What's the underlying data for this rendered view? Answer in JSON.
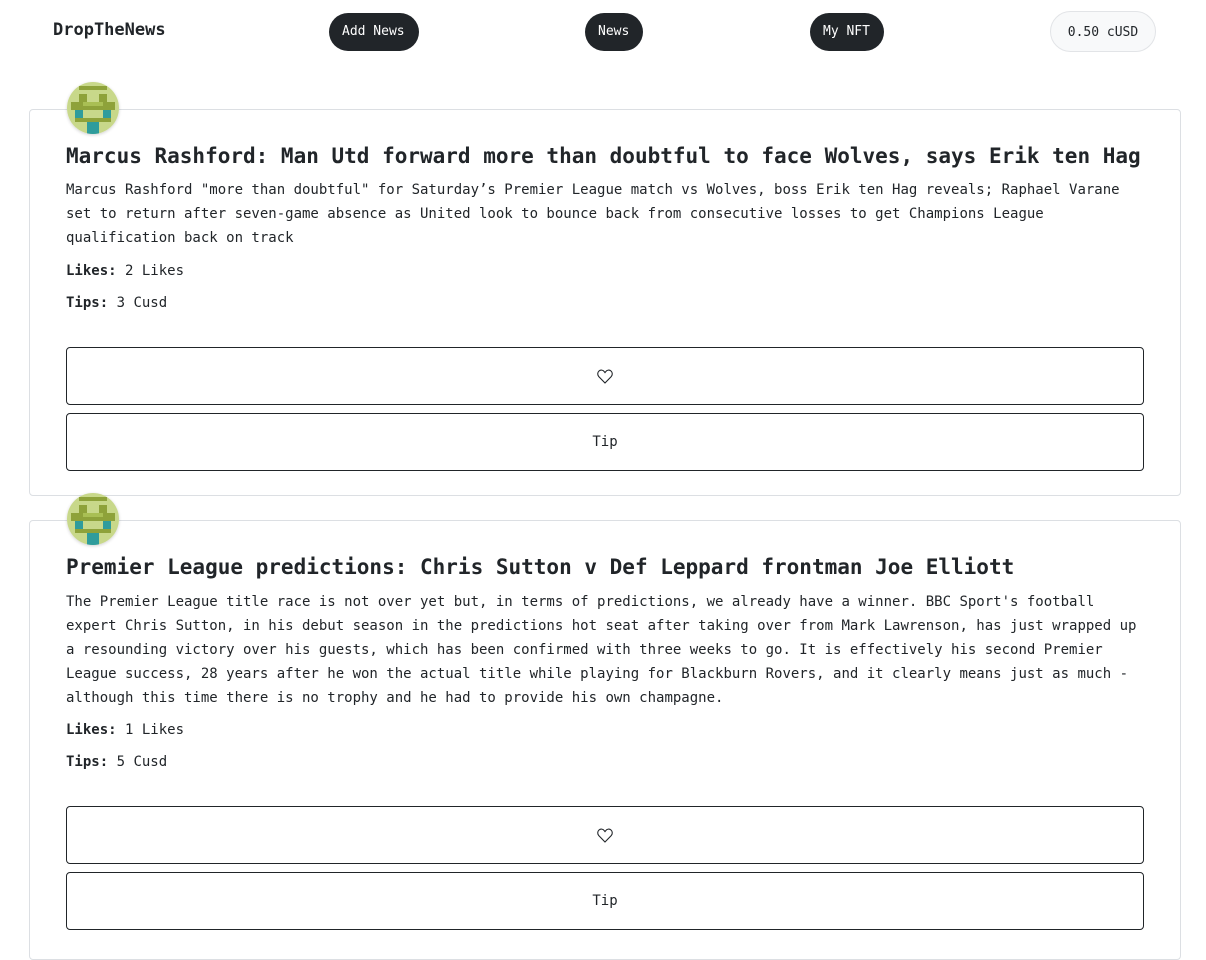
{
  "nav": {
    "brand": "DropTheNews",
    "add_news": "Add News",
    "news": "News",
    "my_nft": "My NFT",
    "balance": "0.50 cUSD"
  },
  "posts": [
    {
      "title": "Marcus Rashford: Man Utd forward more than doubtful to face Wolves, says Erik ten Hag",
      "body": "Marcus Rashford \"more than doubtful\" for Saturday’s Premier League match vs Wolves, boss Erik ten Hag reveals; Raphael Varane set to return after seven-game absence as United look to bounce back from consecutive losses to get Champions League qualification back on track",
      "likes_label": "Likes:",
      "likes_value": "2 Likes",
      "tips_label": "Tips:",
      "tips_value": "3 Cusd",
      "like_icon": "heart-outline-icon",
      "tip_label": "Tip"
    },
    {
      "title": "Premier League predictions: Chris Sutton v Def Leppard frontman Joe Elliott",
      "body": "The Premier League title race is not over yet but, in terms of predictions, we already have a winner. BBC Sport's football expert Chris Sutton, in his debut season in the predictions hot seat after taking over from Mark Lawrenson, has just wrapped up a resounding victory over his guests, which has been confirmed with three weeks to go. It is effectively his second Premier League success, 28 years after he won the actual title while playing for Blackburn Rovers, and it clearly means just as much - although this time there is no trophy and he had to provide his own champagne.",
      "likes_label": "Likes:",
      "likes_value": "1 Likes",
      "tips_label": "Tips:",
      "tips_value": "5 Cusd",
      "like_icon": "heart-outline-icon",
      "tip_label": "Tip"
    }
  ],
  "colors": {
    "pill_bg": "#212529",
    "pill_text": "#ffffff",
    "avatar_light": "#c8d88a",
    "avatar_dark": "#8ea23a",
    "avatar_teal": "#2f9c9c"
  }
}
